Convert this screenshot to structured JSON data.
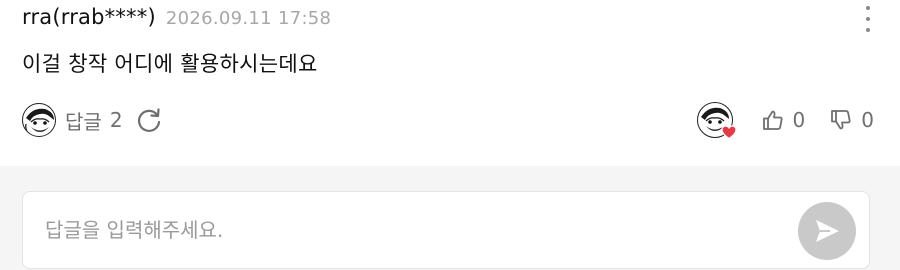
{
  "comment": {
    "author": "rra(rrab****)",
    "timestamp": "2026.09.11 17:58",
    "text": "이걸 창작 어디에 활용하시는데요",
    "reply_label": "답글",
    "reply_count": "2",
    "like_count": "0",
    "dislike_count": "0"
  },
  "reply_box": {
    "placeholder": "답글을 입력해주세요."
  },
  "icons": {
    "more": "more-vertical-icon",
    "refresh": "refresh-icon",
    "thumbs_up": "thumbs-up-icon",
    "thumbs_down": "thumbs-down-icon",
    "send": "send-icon",
    "heart": "heart-icon"
  },
  "colors": {
    "muted_text": "#6f6f6f",
    "timestamp": "#a7a7a7",
    "send_button": "#c9c9c9",
    "heart": "#e53945",
    "page_background": "#f5f5f5"
  }
}
